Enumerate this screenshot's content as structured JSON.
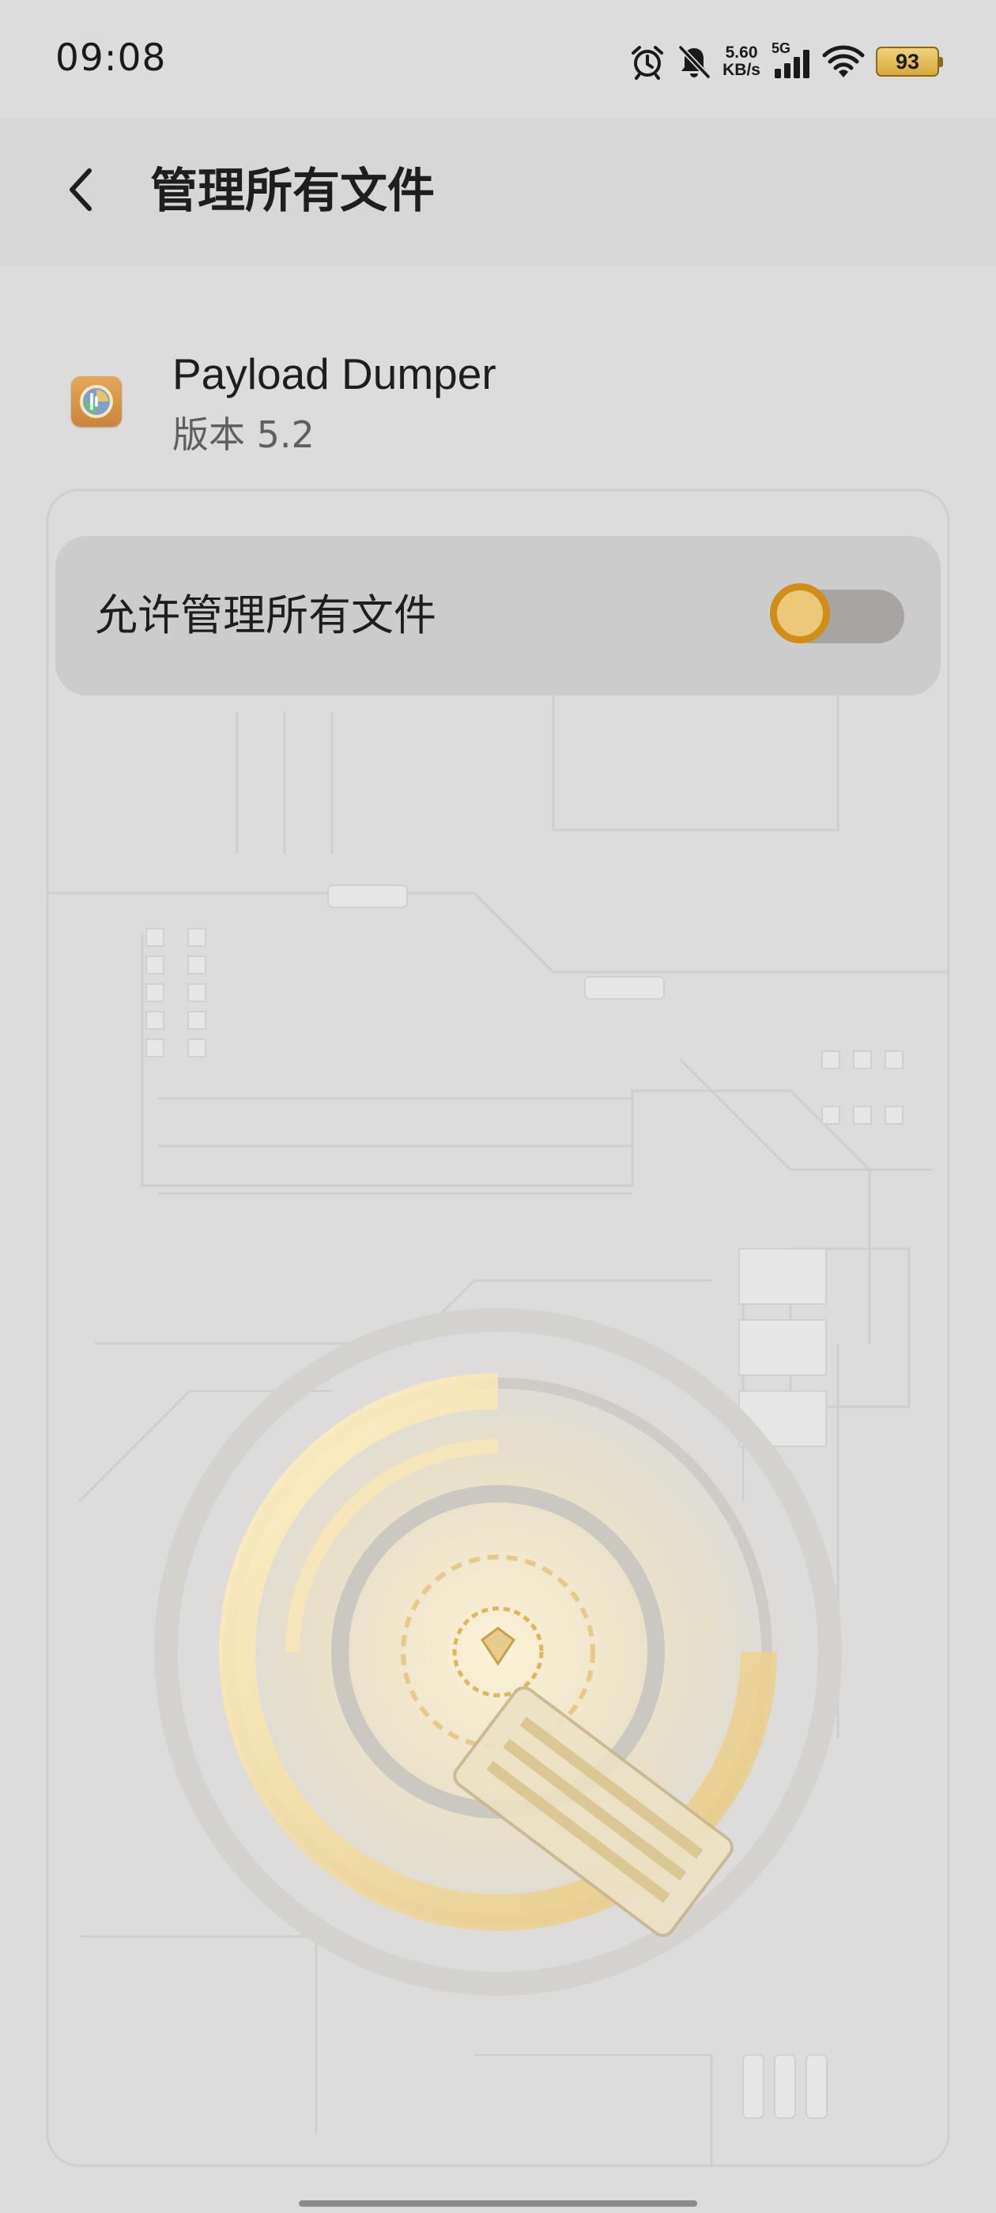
{
  "status_bar": {
    "time": "09:08",
    "net_speed_value": "5.60",
    "net_speed_unit": "KB/s",
    "network_type": "5G",
    "battery_level": "93",
    "icons": [
      "alarm-icon",
      "mute-bell-icon",
      "signal-icon",
      "wifi-icon",
      "battery-icon"
    ]
  },
  "header": {
    "back_icon": "chevron-left-icon",
    "title": "管理所有文件"
  },
  "app": {
    "name": "Payload Dumper",
    "version": "版本 5.2"
  },
  "permission": {
    "label": "允许管理所有文件",
    "enabled": false
  },
  "colors": {
    "background": "#dcdcdd",
    "header_background": "#d8d7d8",
    "card_background": "#c8c8c8",
    "toggle_accent": "#d08d17",
    "toggle_thumb": "#ecc97a",
    "toggle_track": "#a7a4a3",
    "battery": "#e0b54a"
  }
}
